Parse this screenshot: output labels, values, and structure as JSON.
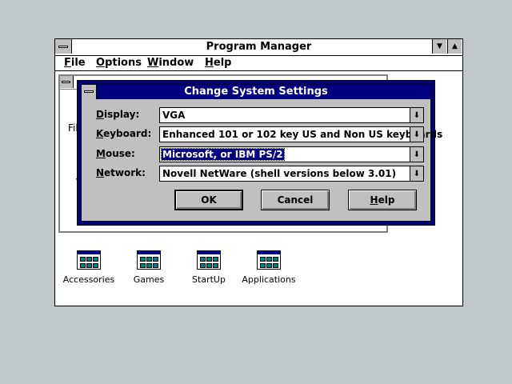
{
  "program_manager": {
    "title": "Program Manager",
    "menu": [
      {
        "label": "File",
        "accel": "F",
        "rest": "ile"
      },
      {
        "label": "Options",
        "accel": "O",
        "rest": "ptions"
      },
      {
        "label": "Window",
        "accel": "W",
        "rest": "indow"
      },
      {
        "label": "Help",
        "accel": "H",
        "rest": "elp"
      }
    ],
    "partial_text": {
      "fil": "Fil",
      "v": "V"
    },
    "group_icons": [
      {
        "label": "Accessories",
        "icon": "program-group-icon"
      },
      {
        "label": "Games",
        "icon": "program-group-icon"
      },
      {
        "label": "StartUp",
        "icon": "program-group-icon"
      },
      {
        "label": "Applications",
        "icon": "program-group-icon"
      }
    ]
  },
  "dialog": {
    "title": "Change System Settings",
    "fields": [
      {
        "label": "Display:",
        "accel": "D",
        "rest": "isplay:",
        "value": "VGA"
      },
      {
        "label": "Keyboard:",
        "accel": "K",
        "rest": "eyboard:",
        "value": "Enhanced 101 or 102 key US and Non US keyboards"
      },
      {
        "label": "Mouse:",
        "accel": "M",
        "rest": "ouse:",
        "value": "Microsoft, or IBM PS/2"
      },
      {
        "label": "Network:",
        "accel": "N",
        "rest": "etwork:",
        "value": "Novell NetWare (shell versions below 3.01)"
      }
    ],
    "buttons": {
      "ok": "OK",
      "cancel": "Cancel",
      "help_accel": "H",
      "help_rest": "elp"
    }
  },
  "colors": {
    "desktop": "#c0c7c8",
    "title_active": "#000080",
    "face": "#c0c0c0",
    "icon_teal": "#008080"
  }
}
